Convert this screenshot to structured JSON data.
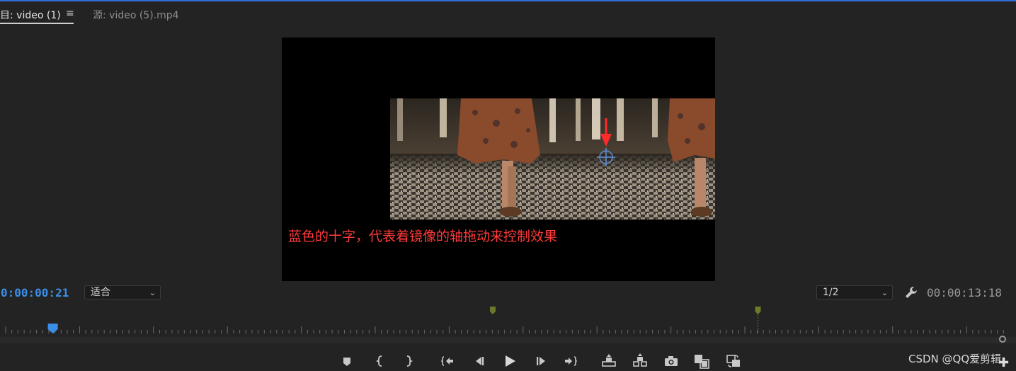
{
  "tabs": [
    {
      "label": "目: video (1)",
      "active": true
    },
    {
      "label": "源: video (5).mp4",
      "active": false
    }
  ],
  "tab_menu_icon": "hamburger-menu-icon",
  "annotation": "蓝色的十字，代表着镜像的轴拖动来控制效果",
  "current_timecode": "0:00:00:21",
  "duration_timecode": "00:00:13:18",
  "fit_select": {
    "value": "适合"
  },
  "resolution_select": {
    "value": "1/2"
  },
  "playhead_position_fraction": 0.052,
  "marker_positions_fraction": [
    0.485,
    0.746
  ],
  "controls": [
    {
      "name": "add-marker-button",
      "icon": "marker-icon"
    },
    {
      "name": "mark-in-button",
      "icon": "mark-in-icon"
    },
    {
      "name": "mark-out-button",
      "icon": "mark-out-icon"
    },
    {
      "name": "go-to-in-button",
      "icon": "go-to-in-icon"
    },
    {
      "name": "step-back-button",
      "icon": "step-back-icon"
    },
    {
      "name": "play-button",
      "icon": "play-icon"
    },
    {
      "name": "step-forward-button",
      "icon": "step-forward-icon"
    },
    {
      "name": "go-to-out-button",
      "icon": "go-to-out-icon"
    },
    {
      "name": "lift-button",
      "icon": "lift-icon"
    },
    {
      "name": "extract-button",
      "icon": "extract-icon"
    },
    {
      "name": "export-frame-button",
      "icon": "camera-icon"
    },
    {
      "name": "comparison-view-button",
      "icon": "comparison-icon"
    },
    {
      "name": "toggle-proxies-button",
      "icon": "proxies-icon"
    }
  ],
  "watermark": "CSDN @QQ爱剪辑",
  "colors": {
    "accent": "#3a8ee6",
    "annotation": "#ff3a3a",
    "marker": "#6b7a2a"
  }
}
